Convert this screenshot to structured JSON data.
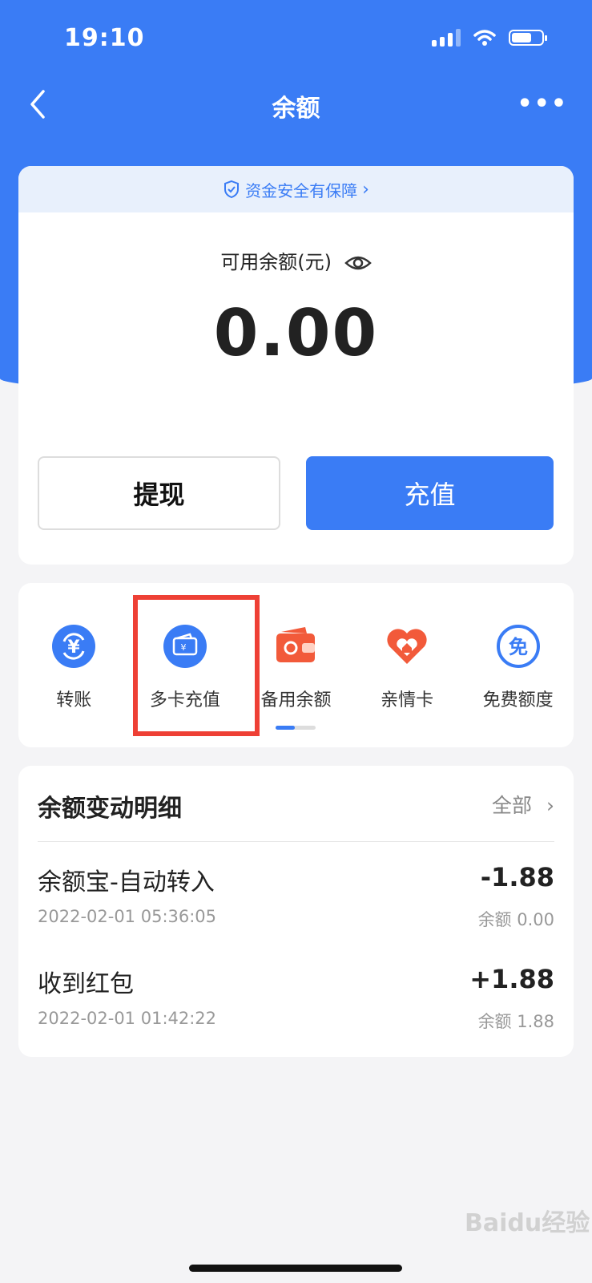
{
  "status_bar": {
    "time": "19:10"
  },
  "nav": {
    "title": "余额"
  },
  "safety": {
    "text": "资金安全有保障"
  },
  "balance": {
    "label": "可用余额(元)",
    "amount": "0.00"
  },
  "buttons": {
    "withdraw": "提现",
    "recharge": "充值"
  },
  "shortcuts": [
    {
      "label": "转账",
      "icon": "transfer-icon"
    },
    {
      "label": "多卡充值",
      "icon": "multi-card-recharge-icon"
    },
    {
      "label": "备用余额",
      "icon": "wallet-icon"
    },
    {
      "label": "亲情卡",
      "icon": "family-card-icon"
    },
    {
      "label": "免费额度",
      "icon": "free-quota-icon"
    }
  ],
  "records": {
    "title": "余额变动明细",
    "all_label": "全部",
    "items": [
      {
        "name": "余额宝-自动转入",
        "time": "2022-02-01 05:36:05",
        "amount": "-1.88",
        "balance": "余额 0.00"
      },
      {
        "name": "收到红包",
        "time": "2022-02-01 01:42:22",
        "amount": "+1.88",
        "balance": "余额 1.88"
      }
    ]
  },
  "watermark": "Baidu经验",
  "colors": {
    "primary": "#3a7cf5",
    "highlight": "#ee4035",
    "orange": "#f25a3a"
  }
}
